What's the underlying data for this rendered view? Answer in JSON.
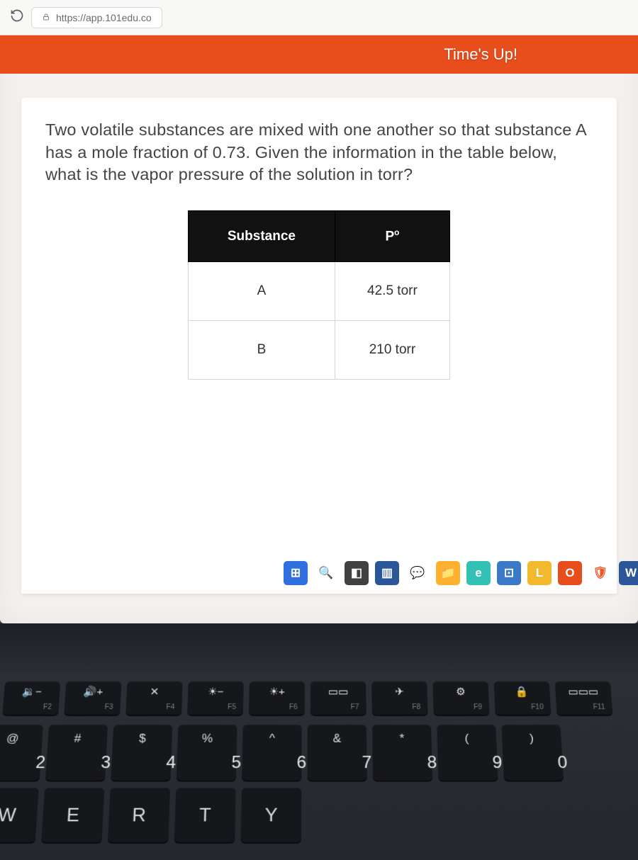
{
  "browser": {
    "url": "https://app.101edu.co"
  },
  "banner": {
    "text": "Time's Up!"
  },
  "question": {
    "text": "Two volatile substances are mixed with one another so that substance A has a mole fraction of 0.73. Given the information in the table below, what is the vapor pressure of the solution in torr?"
  },
  "table": {
    "headers": {
      "col1": "Substance",
      "col2_html": "P°",
      "col2_base": "P",
      "col2_sup": "o"
    },
    "rows": [
      {
        "substance": "A",
        "pressure": "42.5 torr"
      },
      {
        "substance": "B",
        "pressure": "210 torr"
      }
    ]
  },
  "taskbar": [
    {
      "name": "start",
      "bg": "#2f6fe0",
      "glyph": "⊞"
    },
    {
      "name": "search",
      "bg": "#ffffff",
      "glyph": "🔍",
      "fg": "#555"
    },
    {
      "name": "cortana",
      "bg": "#404142",
      "glyph": "◧"
    },
    {
      "name": "word",
      "bg": "#2b579a",
      "glyph": "▥"
    },
    {
      "name": "chat",
      "bg": "#ffffff",
      "glyph": "💬",
      "fg": "#3aa0e8"
    },
    {
      "name": "files",
      "bg": "#ffb02e",
      "glyph": "📁"
    },
    {
      "name": "edge",
      "bg": "#34c1b5",
      "glyph": "e"
    },
    {
      "name": "store",
      "bg": "#3a78c8",
      "glyph": "⊡"
    },
    {
      "name": "lock",
      "bg": "#f2b92f",
      "glyph": "L",
      "fg": "#fff"
    },
    {
      "name": "opera",
      "bg": "#e84d1c",
      "glyph": "O"
    },
    {
      "name": "brave",
      "bg": "#ffffff",
      "glyph": "🛡",
      "fg": "#f05423"
    },
    {
      "name": "wordw",
      "bg": "#2b579a",
      "glyph": "W"
    }
  ],
  "keyboard": {
    "fn": [
      {
        "glyph": "🔉−",
        "label": "F2"
      },
      {
        "glyph": "🔊+",
        "label": "F3"
      },
      {
        "glyph": "✕",
        "label": "F4"
      },
      {
        "glyph": "☀−",
        "label": "F5"
      },
      {
        "glyph": "☀+",
        "label": "F6"
      },
      {
        "glyph": "▭▭",
        "label": "F7"
      },
      {
        "glyph": "✈",
        "label": "F8"
      },
      {
        "glyph": "⚙",
        "label": "F9"
      },
      {
        "glyph": "🔒",
        "label": "F10"
      },
      {
        "glyph": "▭▭▭",
        "label": "F11"
      }
    ],
    "nums": [
      {
        "sym": "@",
        "num": "2"
      },
      {
        "sym": "#",
        "num": "3"
      },
      {
        "sym": "$",
        "num": "4"
      },
      {
        "sym": "%",
        "num": "5"
      },
      {
        "sym": "^",
        "num": "6"
      },
      {
        "sym": "&",
        "num": "7"
      },
      {
        "sym": "*",
        "num": "8"
      },
      {
        "sym": "(",
        "num": "9"
      },
      {
        "sym": ")",
        "num": "0"
      }
    ],
    "letters": [
      "W",
      "E",
      "R",
      "T",
      "Y"
    ]
  }
}
